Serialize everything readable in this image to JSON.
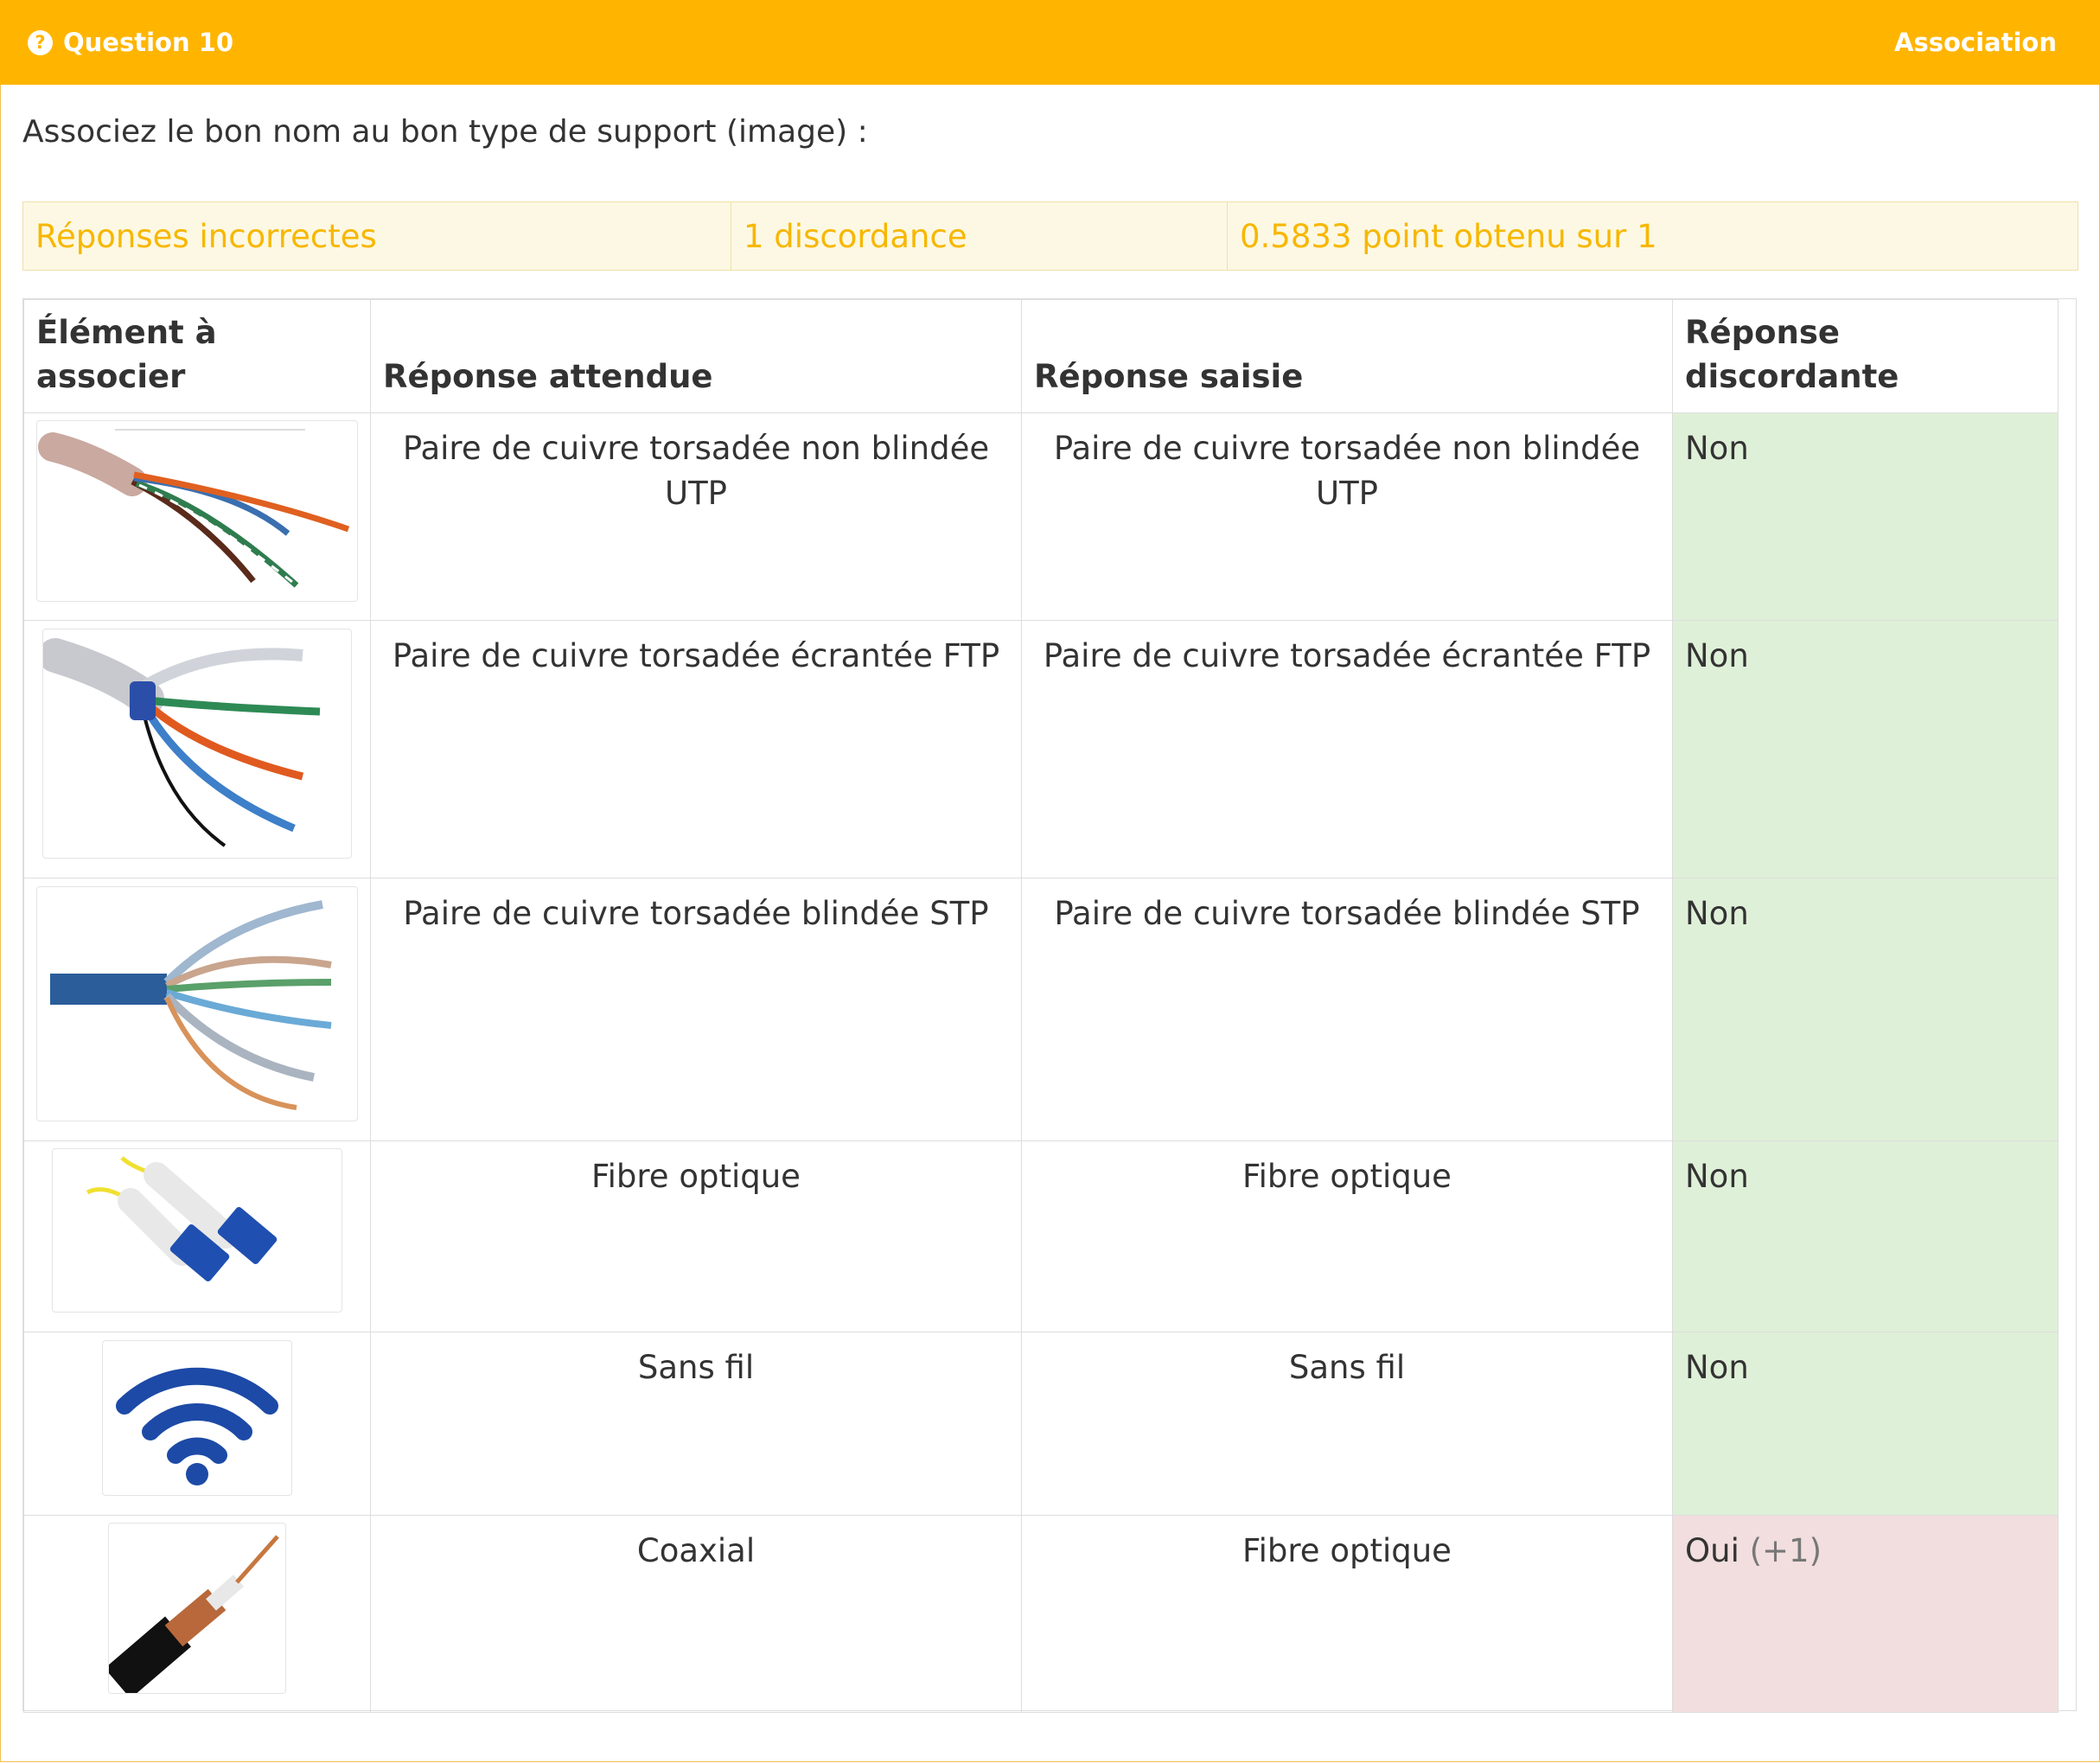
{
  "header": {
    "question_label": "Question 10",
    "type_label": "Association",
    "help_icon": "question-circle-icon"
  },
  "prompt": "Associez le bon nom au bon type de support (image) :",
  "summary": {
    "status": "Réponses incorrectes",
    "discordance": "1  discordance",
    "score": "0.5833 point obtenu sur 1"
  },
  "colors": {
    "header": "#ffb500",
    "summary_text": "#f7b700",
    "correct_bg": "#dff0d8",
    "wrong_bg": "#f2dede"
  },
  "table": {
    "headers": {
      "element": "Élément à associer",
      "expected": "Réponse attendue",
      "entered": "Réponse saisie",
      "discordant": "Réponse discordante"
    },
    "rows": [
      {
        "image": "utp-cable-image",
        "expected": "Paire de cuivre torsadée non blindée UTP",
        "entered": "Paire de cuivre torsadée non blindée UTP",
        "discordant": "Non",
        "bonus": ""
      },
      {
        "image": "ftp-cable-image",
        "expected": "Paire de cuivre torsadée écrantée FTP",
        "entered": "Paire de cuivre torsadée écrantée FTP",
        "discordant": "Non",
        "bonus": ""
      },
      {
        "image": "stp-cable-image",
        "expected": "Paire de cuivre torsadée blindée STP",
        "entered": "Paire de cuivre torsadée blindée STP",
        "discordant": "Non",
        "bonus": ""
      },
      {
        "image": "fiber-optic-image",
        "expected": "Fibre optique",
        "entered": "Fibre optique",
        "discordant": "Non",
        "bonus": ""
      },
      {
        "image": "wifi-icon",
        "expected": "Sans fil",
        "entered": "Sans fil",
        "discordant": "Non",
        "bonus": ""
      },
      {
        "image": "coaxial-cable-image",
        "expected": "Coaxial",
        "entered": "Fibre optique",
        "discordant": "Oui",
        "bonus": "(+1)"
      }
    ]
  }
}
